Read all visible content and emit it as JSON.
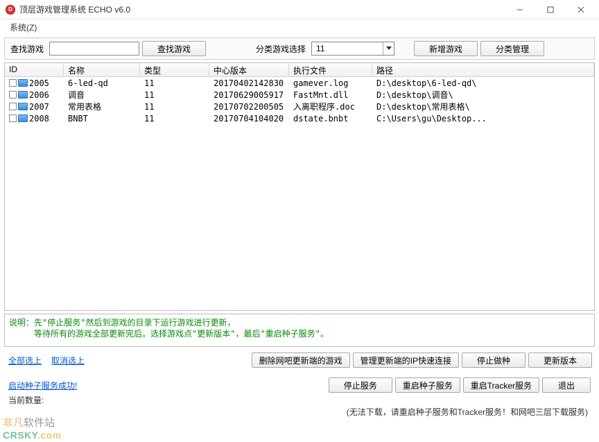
{
  "window": {
    "title": "顶层游戏管理系统  ECHO v6.0",
    "icon_letter": "D"
  },
  "menu": {
    "system": "系统(Z)"
  },
  "toolbar": {
    "search_label": "查找游戏",
    "search_value": "",
    "search_btn": "查找游戏",
    "category_label": "分类游戏选择",
    "category_value": "11",
    "add_btn": "新增游戏",
    "manage_btn": "分类管理"
  },
  "table": {
    "headers": {
      "id": "ID",
      "name": "名称",
      "type": "类型",
      "ver": "中心版本",
      "exec": "执行文件",
      "path": "路径"
    },
    "rows": [
      {
        "id": "2005",
        "name": "6-led-qd",
        "type": "11",
        "ver": "20170402142830",
        "exec": "gamever.log",
        "path": "D:\\desktop\\6-led-qd\\"
      },
      {
        "id": "2006",
        "name": "调音",
        "type": "11",
        "ver": "20170629005917",
        "exec": "FastMnt.dll",
        "path": "D:\\desktop\\调音\\"
      },
      {
        "id": "2007",
        "name": "常用表格",
        "type": "11",
        "ver": "20170702200505",
        "exec": "入离职程序.doc",
        "path": "D:\\desktop\\常用表格\\"
      },
      {
        "id": "2008",
        "name": "BNBT",
        "type": "11",
        "ver": "20170704104020",
        "exec": "dstate.bnbt",
        "path": "C:\\Users\\gu\\Desktop..."
      }
    ]
  },
  "hint": {
    "line1": "说明：先\"停止服务\"然后到游戏的目录下运行游戏进行更新，",
    "line2": "　　　等待所有的游戏全部更新完后。选择游戏点\"更新版本\"，最后\"重启种子服务\"。"
  },
  "selection": {
    "select_all": "全部选上",
    "deselect_all": "取消选上"
  },
  "mid_buttons": {
    "delete_update": "删除网吧更新端的游戏",
    "manage_ip": "管理更新端的IP快速连接",
    "stop_seed": "停止做种",
    "update_ver": "更新版本"
  },
  "status": {
    "label": "启动种子服务成功!",
    "sub": "当前数量:"
  },
  "bottom_buttons": {
    "stop_service": "停止服务",
    "restart_seed": "重启种子服务",
    "restart_tracker": "重启Tracker服务",
    "exit": "退出"
  },
  "footer_hint": "(无法下载，请重启种子服务和Tracker服务！和网吧三层下载服务)",
  "watermark": {
    "line1_a": "非凡",
    "line1_b": "软件站",
    "line2": "CRSKY",
    "line2_tail": ".com"
  }
}
